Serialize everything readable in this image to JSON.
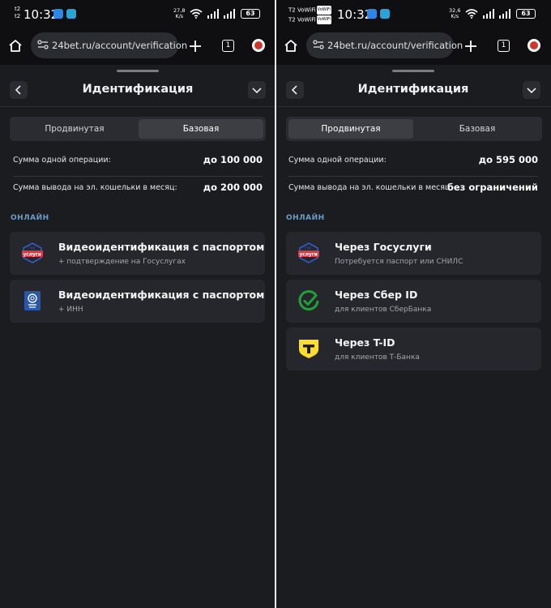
{
  "status_left": {
    "carrier_top": "t2",
    "carrier_bottom": "t2",
    "time": "10:32",
    "speed_value": "27,8",
    "speed_unit": "K/s",
    "battery": "63"
  },
  "status_right": {
    "carrier_top": "T2 VoWiFi",
    "carrier_bottom": "T2 VoWiFi",
    "vowifi_badge": "VoWiFi",
    "time": "10:32",
    "speed_value": "32,6",
    "speed_unit": "K/s",
    "battery": "63"
  },
  "browser": {
    "url": "24bet.ru/account/verification",
    "tab_count": "1"
  },
  "icons": {
    "home": "home-icon",
    "site_settings": "tune-icon",
    "new_tab": "plus-icon",
    "extension": "extension-icon",
    "back": "chevron-left-icon",
    "collapse": "chevron-down-icon"
  },
  "left": {
    "title": "Идентификация",
    "tabs": [
      {
        "label": "Продвинутая",
        "active": false
      },
      {
        "label": "Базовая",
        "active": true
      }
    ],
    "limits": [
      {
        "label": "Сумма одной операции:",
        "value": "до 100 000"
      },
      {
        "label": "Сумма вывода на эл. кошельки в месяц:",
        "value": "до 200 000"
      }
    ],
    "section": "ОНЛАЙН",
    "logo_text_small": "гос",
    "logo_text": "услуги",
    "methods": [
      {
        "title": "Видеоидентификация с паспортом",
        "subtitle": "+ подтверждение на Госуслугах",
        "icon": "gosuslugi-icon"
      },
      {
        "title": "Видеоидентификация с паспортом",
        "subtitle": "+ ИНН",
        "icon": "passport-icon"
      }
    ]
  },
  "right": {
    "title": "Идентификация",
    "tabs": [
      {
        "label": "Продвинутая",
        "active": true
      },
      {
        "label": "Базовая",
        "active": false
      }
    ],
    "limits": [
      {
        "label": "Сумма одной операции:",
        "value": "до 595 000"
      },
      {
        "label": "Сумма вывода на эл. кошельки в месяц:",
        "value": "без ограничений"
      }
    ],
    "section": "ОНЛАЙН",
    "logo_text_small": "гос",
    "logo_text": "услуги",
    "methods": [
      {
        "title": "Через Госуслуги",
        "subtitle": "Потребуется паспорт или СНИЛС",
        "icon": "gosuslugi-icon"
      },
      {
        "title": "Через Сбер ID",
        "subtitle": "для клиентов СберБанка",
        "icon": "sber-icon"
      },
      {
        "title": "Через T-ID",
        "subtitle": "для клиентов Т-Банка",
        "icon": "tbank-icon"
      }
    ]
  },
  "colors": {
    "background": "#1b1c20",
    "card": "#26272c",
    "section_label": "#6e9ec8",
    "sber_green": "#21a038",
    "tbank_yellow": "#ffdd2d",
    "passport_blue": "#2a58a8",
    "gosuslugi_red": "#e3343f",
    "gosuslugi_blue": "#2f5cc9"
  }
}
